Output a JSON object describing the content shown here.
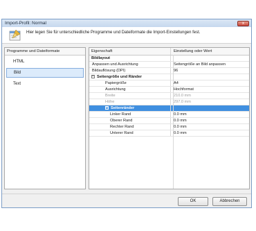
{
  "window": {
    "title": "Import-Profil: Normal",
    "close_label": "x"
  },
  "header": {
    "text": "Hier legen Sie für unterschiedliche Programme und Dateiformate die Import-Einstellungen fest."
  },
  "left_panel": {
    "header": "Programme und Dateiformate",
    "items": [
      {
        "label": "HTML",
        "selected": false
      },
      {
        "label": "Bild",
        "selected": true
      },
      {
        "label": "Text",
        "selected": false
      }
    ]
  },
  "properties": {
    "col_property": "Eigenschaft",
    "col_value": "Einstellung oder Wert",
    "rows": [
      {
        "type": "cat",
        "label": "Bildlayout",
        "value": ""
      },
      {
        "type": "item",
        "label": "Anpassen und Ausrichtung",
        "value": "Seitengröße an Bild anpassen"
      },
      {
        "type": "item",
        "label": "Bildauflösung (DPI)",
        "value": "96"
      },
      {
        "type": "cat",
        "label": "Seitengröße und Ränder",
        "value": "",
        "expander": "−"
      },
      {
        "type": "item",
        "label": "Papiergröße",
        "value": "A4"
      },
      {
        "type": "item",
        "label": "Ausrichtung",
        "value": "Hochformat"
      },
      {
        "type": "disabled",
        "label": "Breite",
        "value": "210.0 mm"
      },
      {
        "type": "disabled",
        "label": "Höhe",
        "value": "297.0 mm"
      },
      {
        "type": "subcat",
        "label": "Seitenränder",
        "value": "",
        "expander": "−"
      },
      {
        "type": "sub",
        "label": "Linker Rand",
        "value": "0.0 mm"
      },
      {
        "type": "sub",
        "label": "Oberer Rand",
        "value": "0.0 mm"
      },
      {
        "type": "sub",
        "label": "Rechter Rand",
        "value": "0.0 mm"
      },
      {
        "type": "sub",
        "label": "Unterer Rand",
        "value": "0.0 mm"
      }
    ]
  },
  "buttons": {
    "ok": "OK",
    "cancel": "Abbrechen"
  }
}
